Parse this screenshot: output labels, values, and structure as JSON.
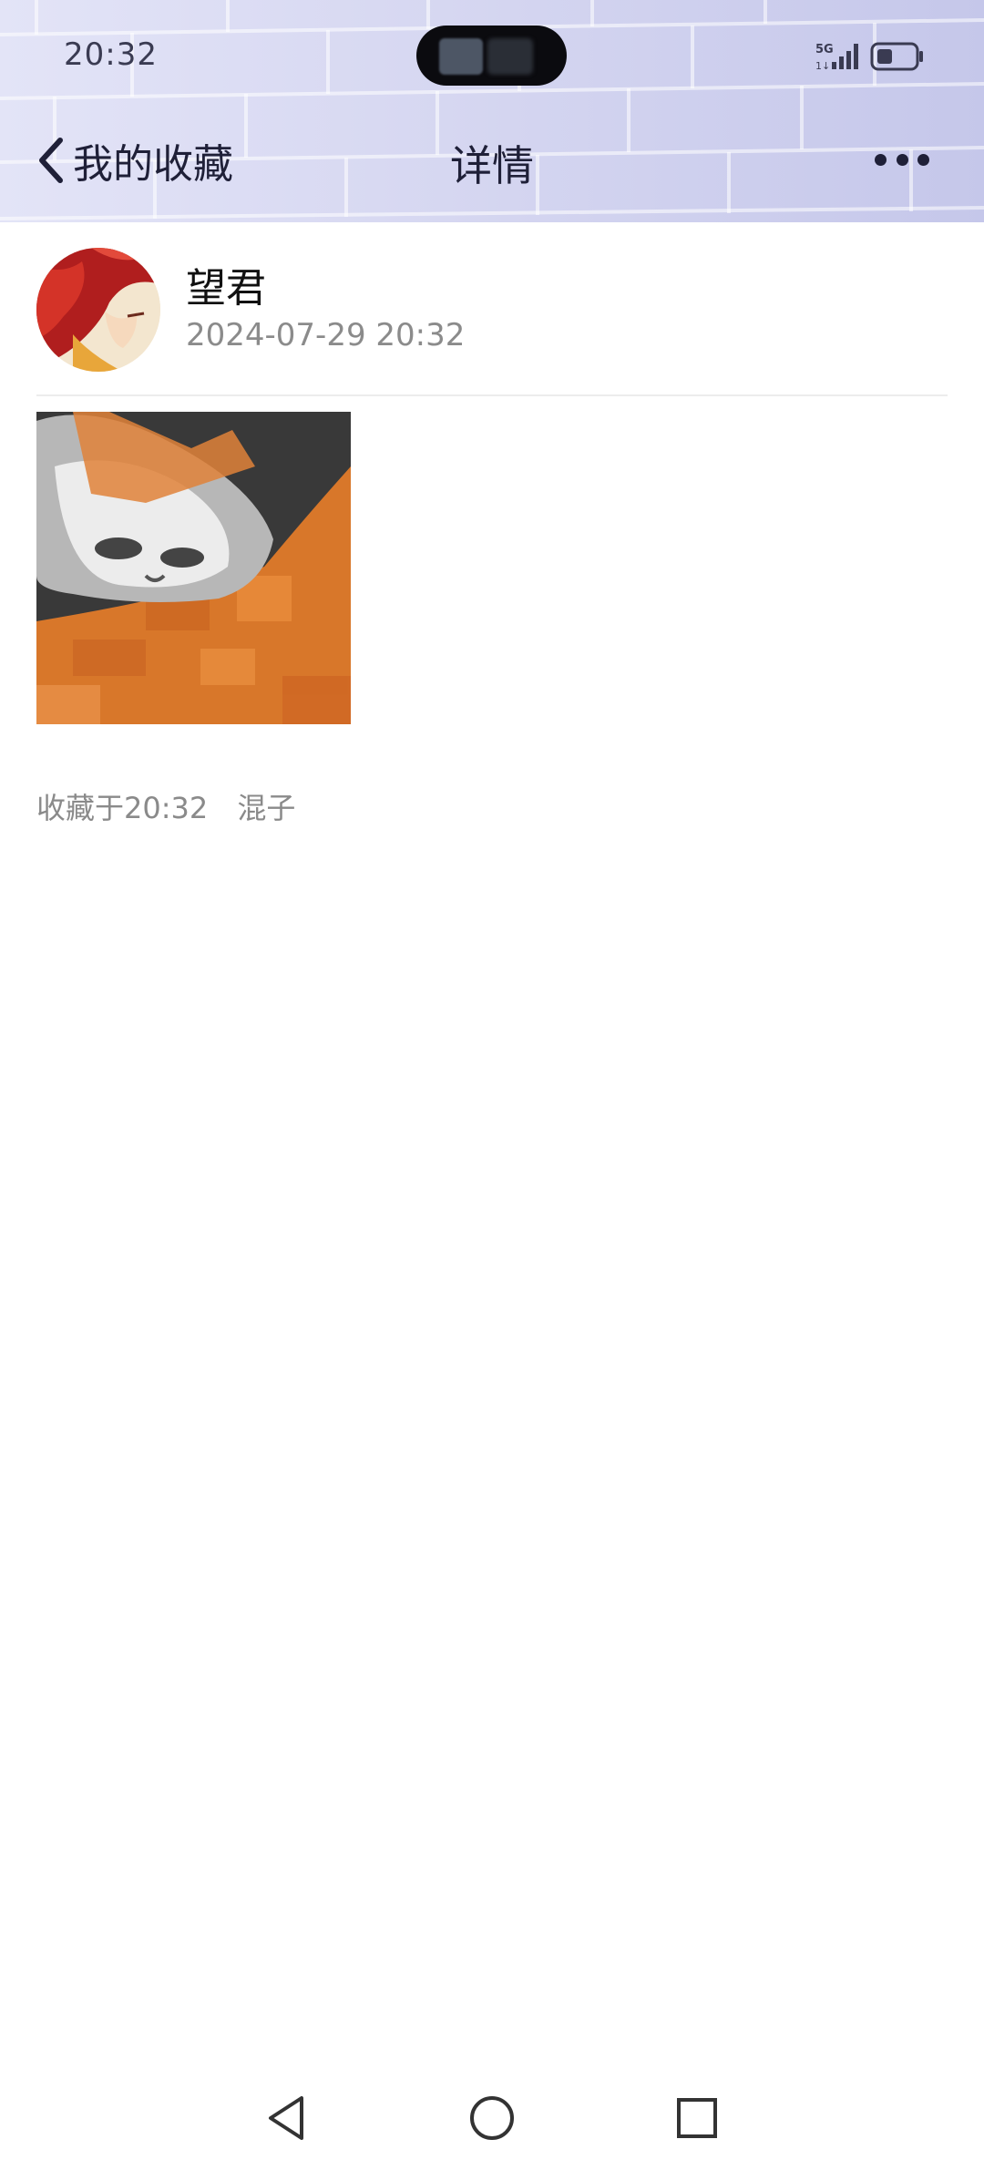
{
  "status_bar": {
    "time": "20:32",
    "network": "5G",
    "signal_icon": "signal-bars-icon",
    "battery_icon": "battery-icon"
  },
  "header": {
    "back_label": "我的收藏",
    "title": "详情",
    "more_icon": "more-dots-icon"
  },
  "post": {
    "author_name": "望君",
    "timestamp": "2024-07-29 20:32",
    "image_desc": "cat-photo",
    "favorited_at": "收藏于20:32",
    "tag": "混子"
  },
  "nav_bar": {
    "back_icon": "triangle-back-icon",
    "home_icon": "circle-home-icon",
    "recent_icon": "square-recent-icon"
  }
}
